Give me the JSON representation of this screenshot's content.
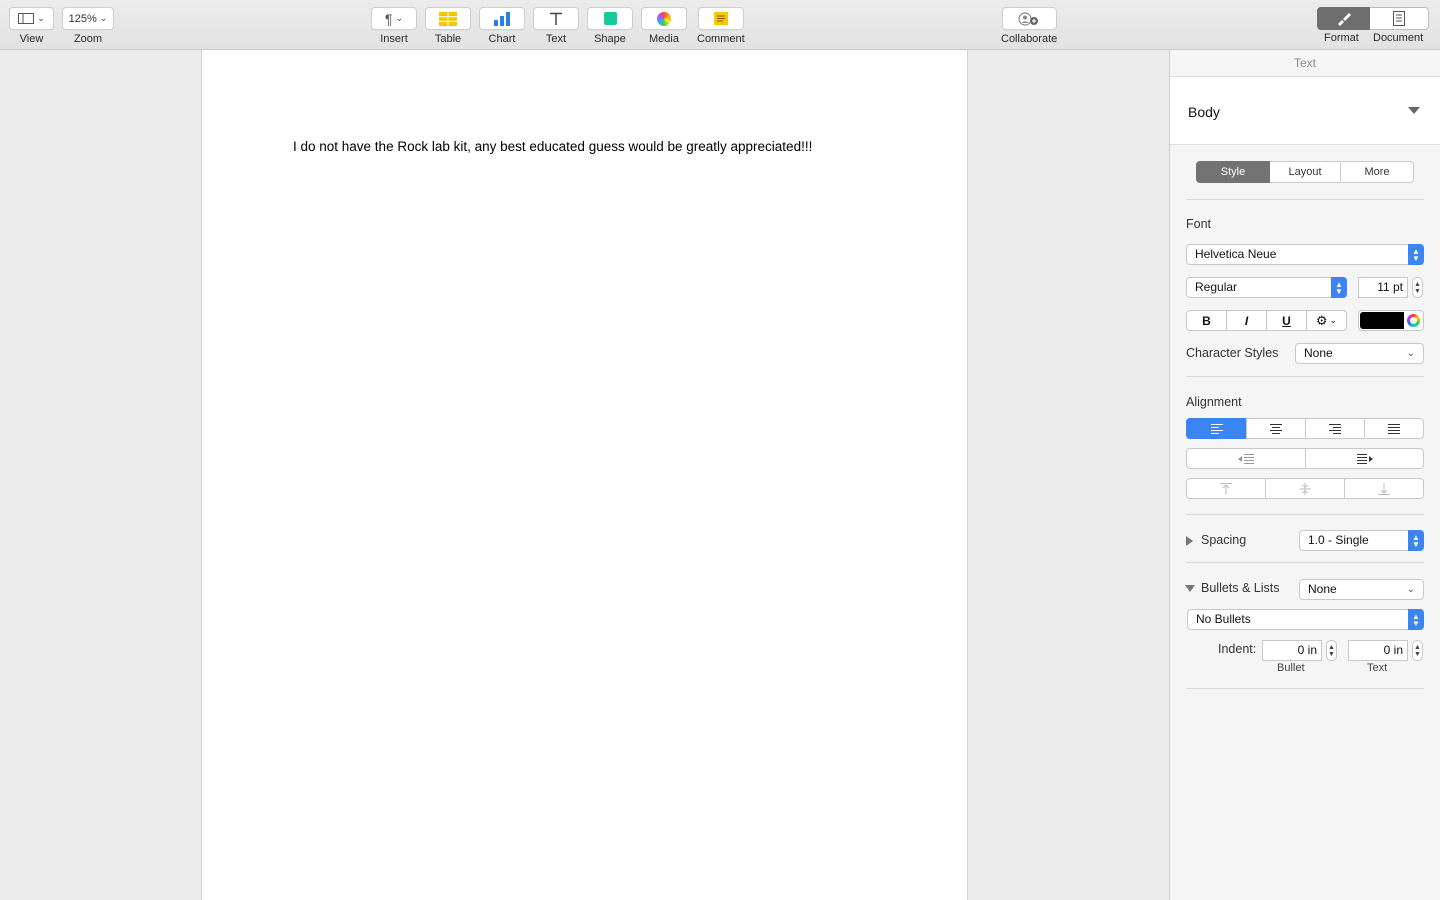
{
  "toolbar": {
    "view_label": "View",
    "zoom_value": "125%",
    "zoom_label": "Zoom",
    "insert_label": "Insert",
    "table_label": "Table",
    "chart_label": "Chart",
    "text_label": "Text",
    "shape_label": "Shape",
    "media_label": "Media",
    "comment_label": "Comment",
    "collaborate_label": "Collaborate",
    "format_label": "Format",
    "document_label": "Document"
  },
  "document": {
    "body_text": "I do not have the Rock lab kit, any best educated guess would be greatly appreciated!!!"
  },
  "inspector": {
    "header": "Text",
    "paragraph_style": "Body",
    "tabs": [
      "Style",
      "Layout",
      "More"
    ],
    "active_tab": "Style",
    "font_heading": "Font",
    "font_family": "Helvetica Neue",
    "font_typeface": "Regular",
    "font_size": "11 pt",
    "bold": "B",
    "italic": "I",
    "underline": "U",
    "text_color": "#000000",
    "character_styles_label": "Character Styles",
    "character_styles_value": "None",
    "alignment_heading": "Alignment",
    "spacing_label": "Spacing",
    "spacing_value": "1.0 - Single",
    "bullets_label": "Bullets & Lists",
    "bullets_value": "None",
    "bullets_style": "No Bullets",
    "indent_label": "Indent:",
    "indent_bullet_value": "0 in",
    "indent_text_value": "0 in",
    "indent_bullet_caption": "Bullet",
    "indent_text_caption": "Text"
  },
  "colors": {
    "accent": "#3b84f2",
    "active_segment": "#6e6e6e"
  }
}
